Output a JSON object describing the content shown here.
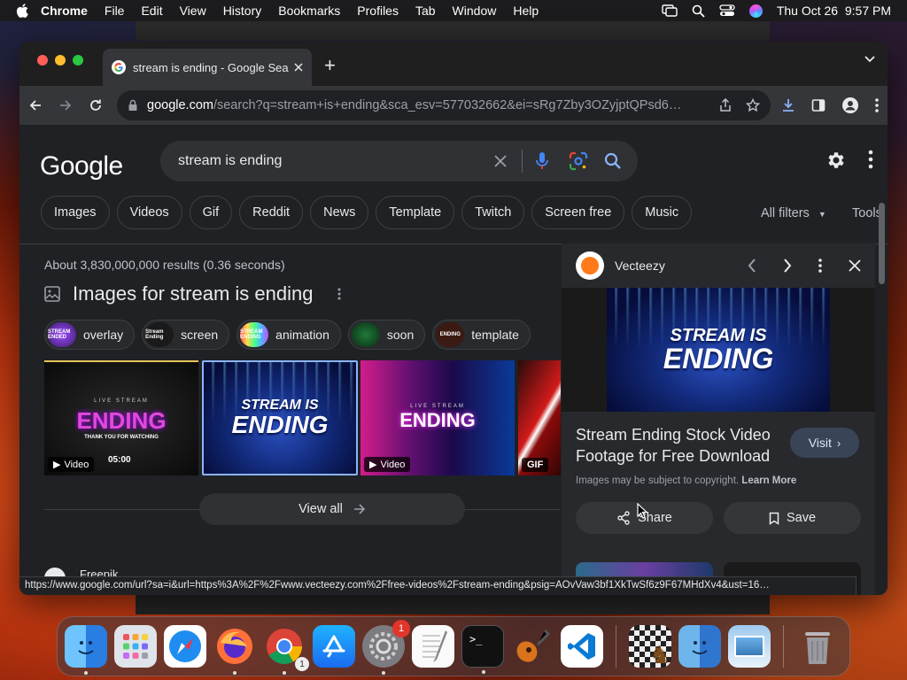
{
  "menubar": {
    "app": "Chrome",
    "items": [
      "File",
      "Edit",
      "View",
      "History",
      "Bookmarks",
      "Profiles",
      "Tab",
      "Window",
      "Help"
    ],
    "datetime": "Thu Oct 26  9:57 PM"
  },
  "browser": {
    "tab_title": "stream is ending - Google Sea",
    "url_host": "google.com",
    "url_rest": "/search?q=stream+is+ending&sca_esv=577032662&ei=sRg7Zby3OZyjptQPsd6…"
  },
  "google": {
    "logo": "Google",
    "query": "stream is ending",
    "filter_chips": [
      "Images",
      "Videos",
      "Gif",
      "Reddit",
      "News",
      "Template",
      "Twitch",
      "Screen free",
      "Music"
    ],
    "all_filters": "All filters",
    "tools": "Tools",
    "stats": "About 3,830,000,000 results (0.36 seconds)",
    "images_heading": "Images for stream is ending",
    "refine_chips": [
      {
        "label": "overlay",
        "thumb": "STREAM ENDED"
      },
      {
        "label": "screen",
        "thumb": "Stream Ending"
      },
      {
        "label": "animation",
        "thumb": "STREAM ENDING"
      },
      {
        "label": "soon",
        "thumb": ""
      },
      {
        "label": "template",
        "thumb": "ENDING"
      }
    ],
    "thumbnails": [
      {
        "top": "LIVE STREAM",
        "title": "ENDING",
        "sub": "THANK YOU FOR WATCHING",
        "time": "05:00",
        "badge": "Video"
      },
      {
        "title1": "STREAM IS",
        "title2": "ENDING"
      },
      {
        "top": "LIVE STREAM",
        "title": "ENDING",
        "badge": "Video"
      },
      {
        "badge": "GIF"
      }
    ],
    "view_all": "View all",
    "next_result_source": "Freepik"
  },
  "panel": {
    "source": "Vecteezy",
    "image_line1": "STREAM IS",
    "image_line2": "ENDING",
    "title": "Stream Ending Stock Video Footage for Free Download",
    "visit": "Visit",
    "copyright": "Images may be subject to copyright.",
    "learn_more": "Learn More",
    "share": "Share",
    "save": "Save"
  },
  "status_url": "https://www.google.com/url?sa=i&url=https%3A%2F%2Fwww.vecteezy.com%2Ffree-videos%2Fstream-ending&psig=AOvVaw3bf1XkTwSf6z9F67MHdXv4&ust=16…",
  "dock": {
    "apps": [
      "finder",
      "launchpad",
      "safari",
      "firefox",
      "chrome",
      "app-store",
      "system-settings",
      "textedit",
      "terminal",
      "garageband",
      "vscode",
      "chess",
      "preview-finder",
      "preview",
      "trash"
    ],
    "chrome_badge": "1",
    "settings_badge": "1"
  },
  "colors": {
    "accent": "#8ab4f8",
    "background": "#202124",
    "panel": "#28292c",
    "visit_bg": "#394457"
  }
}
